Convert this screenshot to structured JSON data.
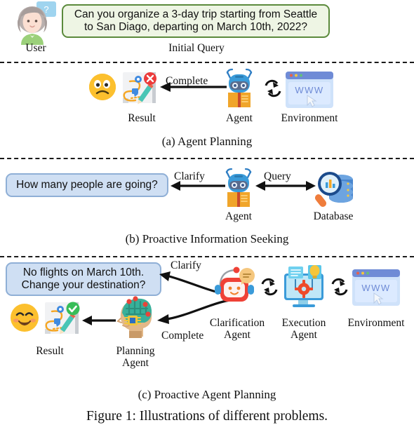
{
  "figure": {
    "caption": "Figure 1: Illustrations of different problems."
  },
  "top": {
    "user_label": "User",
    "user_icon": "user-avatar-icon",
    "question_bubble_icon": "question-mark-speech-bubble-icon",
    "query_text_line1": "Can you organize a 3-day trip starting from Seattle",
    "query_text_line2": "to San Diago, departing on March 10th, 2022?",
    "query_label": "Initial Query",
    "bubble_bg": "#eef5e4",
    "bubble_border": "#5b8a3c"
  },
  "panel_a": {
    "caption": "(a) Agent Planning",
    "result_label": "Result",
    "agent_label": "Agent",
    "environment_label": "Environment",
    "arrow_label": "Complete",
    "sad_face_icon": "worried-face-emoji-icon",
    "result_map_icon": "map-plan-failed-icon",
    "agent_icon": "blue-robot-agent-icon",
    "sync_icon": "two-way-sync-arrows-icon",
    "environment_icon": "browser-www-window-icon",
    "environment_text": "WWW"
  },
  "panel_b": {
    "caption": "(b) Proactive Information Seeking",
    "clarify_bubble_text": "How many people are going?",
    "clarify_arrow_label": "Clarify",
    "query_arrow_label": "Query",
    "agent_label": "Agent",
    "database_label": "Database",
    "agent_icon": "blue-robot-agent-icon",
    "database_icon": "database-search-icon",
    "bubble_bg": "#cfdff3",
    "bubble_border": "#8fafd6"
  },
  "panel_c": {
    "caption": "(c) Proactive Agent Planning",
    "clarify_bubble_line1": "No flights on March 10th.",
    "clarify_bubble_line2": "Change your destination?",
    "clarify_arrow_label": "Clarify",
    "complete_arrow_label": "Complete",
    "result_label": "Result",
    "planning_agent_label_line1": "Planning",
    "planning_agent_label_line2": "Agent",
    "clarification_agent_label_line1": "Clarification",
    "clarification_agent_label_line2": "Agent",
    "execution_agent_label_line1": "Execution",
    "execution_agent_label_line2": "Agent",
    "environment_label": "Environment",
    "happy_face_icon": "smiling-face-emoji-icon",
    "result_map_icon": "map-plan-success-icon",
    "planning_agent_icon": "ai-brain-head-icon",
    "clarification_agent_icon": "red-robot-chat-icon",
    "execution_agent_icon": "monitor-gear-icon",
    "environment_icon": "browser-www-window-icon",
    "environment_text": "WWW",
    "sync_icon": "two-way-sync-arrows-icon"
  }
}
